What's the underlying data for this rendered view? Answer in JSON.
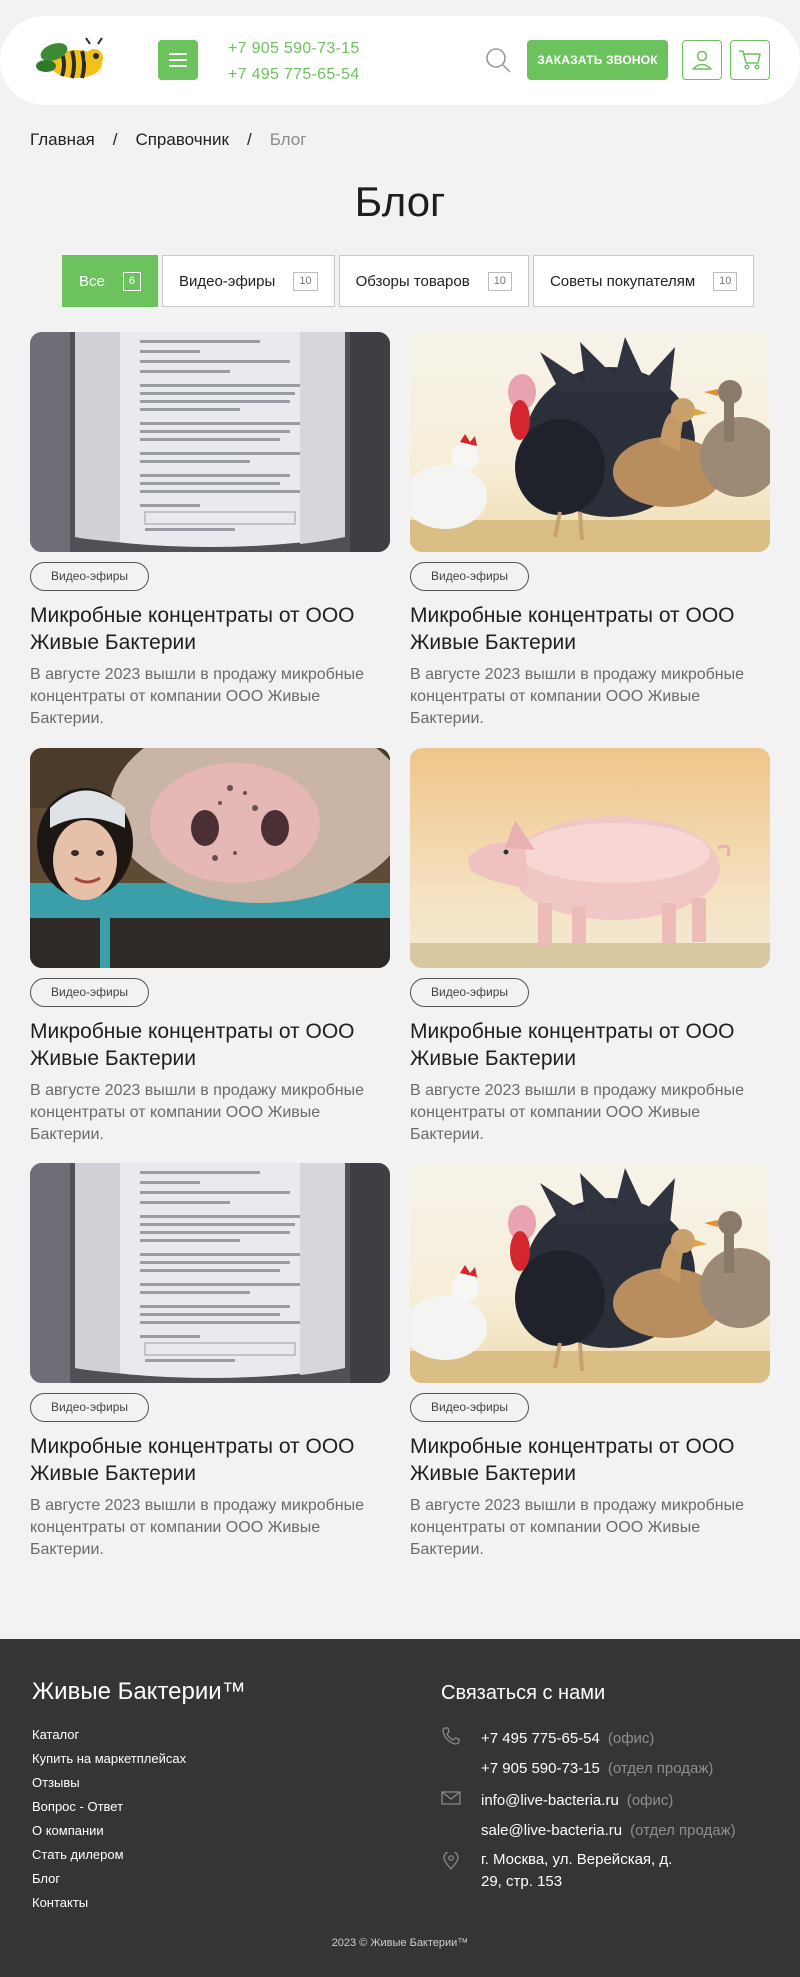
{
  "header": {
    "phones": [
      "+7 905 590-73-15",
      "+7 495 775-65-54"
    ],
    "callback_label": "ЗАКАЗАТЬ ЗВОНОК"
  },
  "breadcrumb": {
    "home": "Главная",
    "section": "Справочник",
    "current": "Блог",
    "separator": "/"
  },
  "page_title": "Блог",
  "tabs": [
    {
      "label": "Все",
      "count": "6"
    },
    {
      "label": "Видео-эфиры",
      "count": "10"
    },
    {
      "label": "Обзоры товаров",
      "count": "10"
    },
    {
      "label": "Советы покупателям",
      "count": "10"
    }
  ],
  "articles": [
    {
      "tag": "Видео-эфиры",
      "title": "Микробные концентраты от ООО Живые Бактерии",
      "text": "В августе 2023 вышли в продажу микробные концентраты от компании ООО Живые Бактерии."
    },
    {
      "tag": "Видео-эфиры",
      "title": "Микробные концентраты от ООО Живые Бактерии",
      "text": "В августе 2023 вышли в продажу микробные концентраты от компании ООО Живые Бактерии."
    },
    {
      "tag": "Видео-эфиры",
      "title": "Микробные концентраты от ООО Живые Бактерии",
      "text": "В августе 2023 вышли в продажу микробные концентраты от компании ООО Живые Бактерии."
    },
    {
      "tag": "Видео-эфиры",
      "title": "Микробные концентраты от ООО Живые Бактерии",
      "text": "В августе 2023 вышли в продажу микробные концентраты от компании ООО Живые Бактерии."
    },
    {
      "tag": "Видео-эфиры",
      "title": "Микробные концентраты от ООО Живые Бактерии",
      "text": "В августе 2023 вышли в продажу микробные концентраты от компании ООО Живые Бактерии."
    },
    {
      "tag": "Видео-эфиры",
      "title": "Микробные концентраты от ООО Живые Бактерии",
      "text": "В августе 2023 вышли в продажу микробные концентраты от компании ООО Живые Бактерии."
    }
  ],
  "footer": {
    "brand": "Живые Бактерии™",
    "nav": [
      "Каталог",
      "Купить на маркетплейсах",
      "Отзывы",
      "Вопрос - Ответ",
      "О компании",
      "Стать дилером",
      "Блог",
      "Контакты"
    ],
    "contacts_title": "Связаться с нами",
    "phones": [
      {
        "value": "+7 495 775-65-54",
        "note": "(офис)"
      },
      {
        "value": "+7 905 590-73-15",
        "note": "(отдел продаж)"
      }
    ],
    "emails": [
      {
        "value": "info@live-bacteria.ru",
        "note": "(офис)"
      },
      {
        "value": "sale@live-bacteria.ru",
        "note": "(отдел продаж)"
      }
    ],
    "address": [
      "г. Москва, ул. Верейская, д.",
      "29, стр. 153"
    ],
    "copyright": "2023 © Живые Бактерии™"
  },
  "colors": {
    "accent": "#6cc25c",
    "footer_bg": "#353535",
    "page_bg": "#f2f2f2"
  },
  "icons": [
    "bee-logo",
    "menu-icon",
    "search-icon",
    "user-icon",
    "cart-icon",
    "phone-icon",
    "mail-icon",
    "location-icon"
  ]
}
